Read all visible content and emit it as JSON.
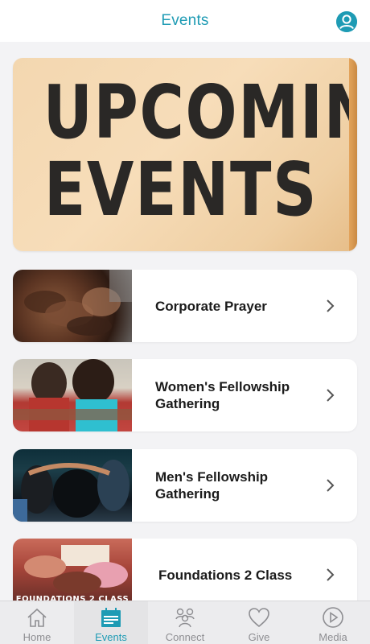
{
  "header": {
    "title": "Events",
    "profile_icon": "user-circle-icon"
  },
  "hero": {
    "line1": "UPCOMING",
    "line2": "EVENTS"
  },
  "events": [
    {
      "label": "Corporate Prayer",
      "thumb": "praying-hands-photo"
    },
    {
      "label": "Women's Fellowship Gathering",
      "thumb": "women-embracing-photo"
    },
    {
      "label": "Men's Fellowship Gathering",
      "thumb": "men-praying-photo"
    },
    {
      "label": "Foundations 2 Class",
      "thumb": "bible-study-photo",
      "thumb_caption": "FOUNDATIONS 2 CLASS"
    }
  ],
  "tabs": [
    {
      "label": "Home",
      "icon": "house-icon"
    },
    {
      "label": "Events",
      "icon": "calendar-icon",
      "active": true
    },
    {
      "label": "Connect",
      "icon": "people-icon"
    },
    {
      "label": "Give",
      "icon": "heart-icon"
    },
    {
      "label": "Media",
      "icon": "play-circle-icon"
    }
  ],
  "colors": {
    "accent": "#1e9bb4",
    "background": "#f3f3f5",
    "tab_inactive": "#8e8e92"
  }
}
